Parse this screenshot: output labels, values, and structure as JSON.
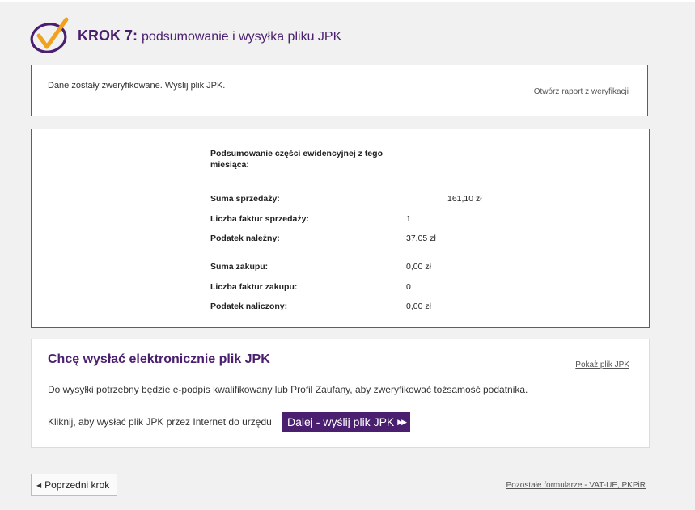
{
  "header": {
    "step_label": "KROK 7:",
    "step_title": "podsumowanie i wysyłka pliku JPK"
  },
  "verification": {
    "message": "Dane zostały zweryfikowane. Wyślij plik JPK.",
    "report_link": "Otwórz raport z weryfikacji"
  },
  "summary": {
    "title": "Podsumowanie części ewidencyjnej z tego miesiąca:",
    "sales": [
      {
        "label": "Suma sprzedaży:",
        "value": "161,10 zł"
      },
      {
        "label": "Liczba faktur sprzedaży:",
        "value": "1"
      },
      {
        "label": "Podatek należny:",
        "value": "37,05 zł"
      }
    ],
    "purchases": [
      {
        "label": "Suma zakupu:",
        "value": "0,00 zł"
      },
      {
        "label": "Liczba faktur zakupu:",
        "value": "0"
      },
      {
        "label": "Podatek naliczony:",
        "value": "0,00 zł"
      }
    ]
  },
  "send": {
    "heading": "Chcę wysłać elektronicznie plik JPK",
    "show_link": "Pokaż plik JPK",
    "description": "Do wysyłki potrzebny będzie e-podpis kwalifikowany lub Profil Zaufany, aby zweryfikować tożsamość podatnika.",
    "instruction": "Kliknij, aby wysłać plik JPK przez Internet do urzędu",
    "button_label": "Dalej - wyślij plik JPK",
    "button_icon": "double-play-arrow-icon"
  },
  "footer": {
    "prev_label": "Poprzedni krok",
    "other_forms_link": "Pozostałe formularze - VAT-UE, PKPiR"
  },
  "colors": {
    "brand": "#4b1f6f",
    "logo_orange": "#f0a11e"
  }
}
